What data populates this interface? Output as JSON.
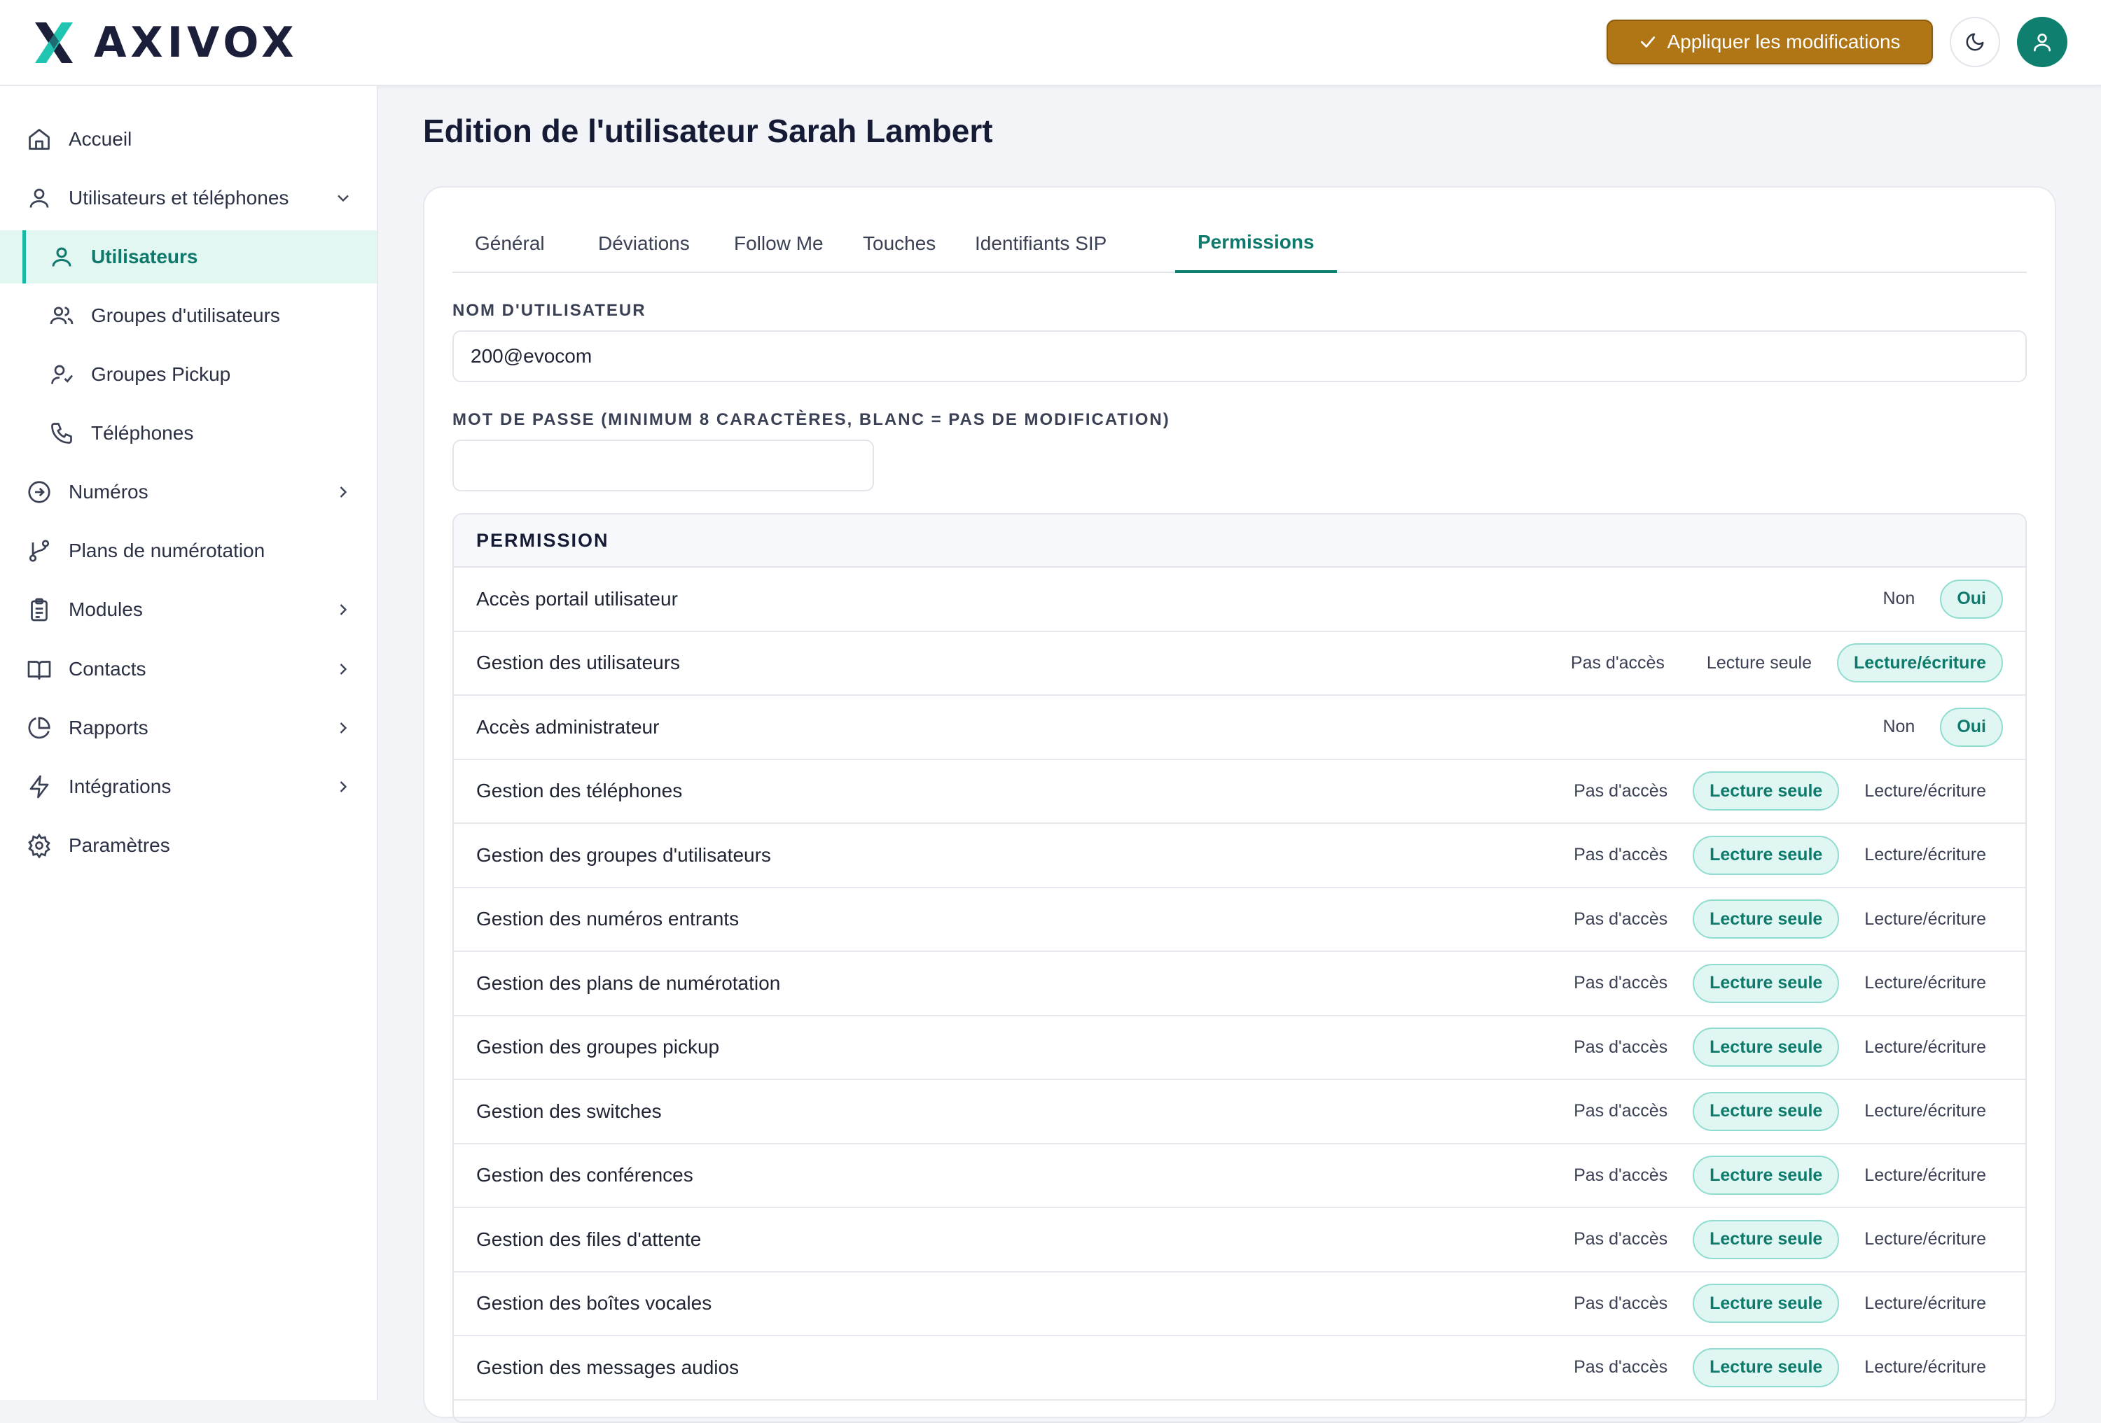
{
  "brand": {
    "name": "AXIVOX",
    "color_primary": "#0f8070",
    "color_accent": "#b07514"
  },
  "header": {
    "apply_button": "Appliquer les modifications",
    "theme_icon": "moon-icon",
    "avatar_icon": "user-icon"
  },
  "sidebar": {
    "items": [
      {
        "label": "Accueil",
        "icon": "home-icon"
      },
      {
        "label": "Utilisateurs et téléphones",
        "icon": "user-icon",
        "chevron": "chevron-down-icon"
      },
      {
        "label": "Utilisateurs",
        "icon": "user-icon",
        "active": true
      },
      {
        "label": "Groupes d'utilisateurs",
        "icon": "users-icon"
      },
      {
        "label": "Groupes Pickup",
        "icon": "user-check-icon"
      },
      {
        "label": "Téléphones",
        "icon": "phone-icon"
      },
      {
        "label": "Numéros",
        "icon": "arrow-circle-icon",
        "chevron": "chevron-right-icon"
      },
      {
        "label": "Plans de numérotation",
        "icon": "git-branch-icon"
      },
      {
        "label": "Modules",
        "icon": "clipboard-icon",
        "chevron": "chevron-right-icon"
      },
      {
        "label": "Contacts",
        "icon": "book-icon",
        "chevron": "chevron-right-icon"
      },
      {
        "label": "Rapports",
        "icon": "pie-chart-icon",
        "chevron": "chevron-right-icon"
      },
      {
        "label": "Intégrations",
        "icon": "bolt-icon",
        "chevron": "chevron-right-icon"
      },
      {
        "label": "Paramètres",
        "icon": "gear-icon"
      }
    ]
  },
  "main": {
    "title": "Edition de l'utilisateur Sarah Lambert",
    "tabs": [
      {
        "label": "Général"
      },
      {
        "label": "Déviations"
      },
      {
        "label": "Follow Me"
      },
      {
        "label": "Touches"
      },
      {
        "label": "Identifiants SIP"
      },
      {
        "label": "Permissions",
        "active": true
      }
    ],
    "username": {
      "label": "NOM D'UTILISATEUR",
      "value": "200@evocom"
    },
    "password": {
      "label": "MOT DE PASSE (MINIMUM 8 CARACTÈRES, BLANC = PAS DE MODIFICATION)",
      "value": ""
    },
    "permissions": {
      "header": "PERMISSION",
      "rows": [
        {
          "name": "Accès portail utilisateur",
          "options": [
            "Non",
            "Oui"
          ],
          "selected": "Oui"
        },
        {
          "name": "Gestion des utilisateurs",
          "options": [
            "Pas d'accès",
            "Lecture seule",
            "Lecture/écriture"
          ],
          "selected": "Lecture/écriture"
        },
        {
          "name": "Accès administrateur",
          "options": [
            "Non",
            "Oui"
          ],
          "selected": "Oui"
        },
        {
          "name": "Gestion des téléphones",
          "options": [
            "Pas d'accès",
            "Lecture seule",
            "Lecture/écriture"
          ],
          "selected": "Lecture seule"
        },
        {
          "name": "Gestion des groupes d'utilisateurs",
          "options": [
            "Pas d'accès",
            "Lecture seule",
            "Lecture/écriture"
          ],
          "selected": "Lecture seule"
        },
        {
          "name": "Gestion des numéros entrants",
          "options": [
            "Pas d'accès",
            "Lecture seule",
            "Lecture/écriture"
          ],
          "selected": "Lecture seule"
        },
        {
          "name": "Gestion des plans de numérotation",
          "options": [
            "Pas d'accès",
            "Lecture seule",
            "Lecture/écriture"
          ],
          "selected": "Lecture seule"
        },
        {
          "name": "Gestion des groupes pickup",
          "options": [
            "Pas d'accès",
            "Lecture seule",
            "Lecture/écriture"
          ],
          "selected": "Lecture seule"
        },
        {
          "name": "Gestion des switches",
          "options": [
            "Pas d'accès",
            "Lecture seule",
            "Lecture/écriture"
          ],
          "selected": "Lecture seule"
        },
        {
          "name": "Gestion des conférences",
          "options": [
            "Pas d'accès",
            "Lecture seule",
            "Lecture/écriture"
          ],
          "selected": "Lecture seule"
        },
        {
          "name": "Gestion des files d'attente",
          "options": [
            "Pas d'accès",
            "Lecture seule",
            "Lecture/écriture"
          ],
          "selected": "Lecture seule"
        },
        {
          "name": "Gestion des boîtes vocales",
          "options": [
            "Pas d'accès",
            "Lecture seule",
            "Lecture/écriture"
          ],
          "selected": "Lecture seule"
        },
        {
          "name": "Gestion des messages audios",
          "options": [
            "Pas d'accès",
            "Lecture seule",
            "Lecture/écriture"
          ],
          "selected": "Lecture seule"
        }
      ]
    }
  }
}
